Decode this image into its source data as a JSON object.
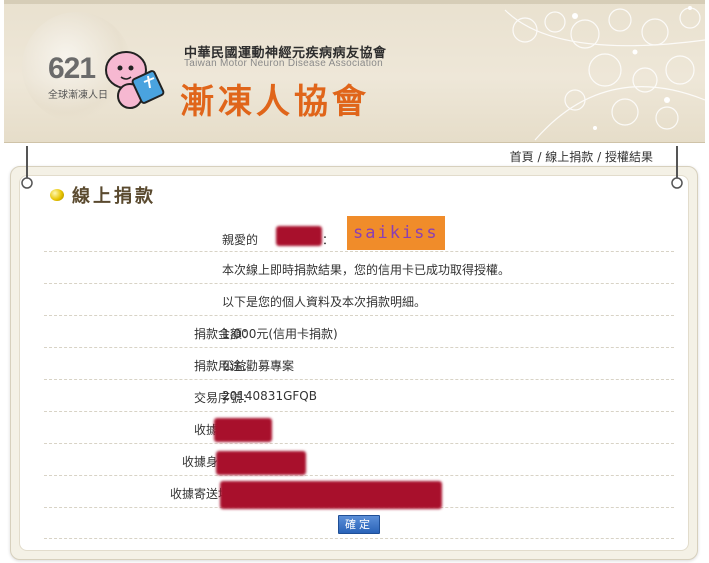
{
  "header": {
    "logo_number": "621",
    "logo_subtitle": "全球漸凍人日",
    "org_name_zh": "中華民國運動神經元疾病病友協會",
    "org_name_en": "Taiwan Motor Neuron Disease Association",
    "org_title": "漸凍人協會"
  },
  "breadcrumb": {
    "home": "首頁",
    "sep1": " / ",
    "online_donation": "線上捐款",
    "sep2": " / ",
    "current": "授權結果"
  },
  "section": {
    "title": "線上捐款"
  },
  "greeting": {
    "prefix": "親愛的",
    "colon": "：",
    "name_highlight": "saikiss"
  },
  "messages": {
    "line1": "本次線上即時捐款結果，您的信用卡已成功取得授權。",
    "line2": "以下是您的個人資料及本次捐款明細。"
  },
  "details": {
    "amount_label": "捐款金額：",
    "amount_value": "1,000元(信用卡捐款)",
    "purpose_label": "捐款用途：",
    "purpose_value": "公益勸募專案",
    "txn_label": "交易序號：",
    "txn_value": "20140831GFQB",
    "receipt_title_label": "收據抬頭：",
    "receipt_id_label": "收據身份證：",
    "receipt_address_label": "收據寄送地址："
  },
  "buttons": {
    "confirm": "確定"
  },
  "colors": {
    "accent_orange": "#e0651a",
    "redaction": "#a8102c",
    "button_blue": "#2a63b8"
  }
}
